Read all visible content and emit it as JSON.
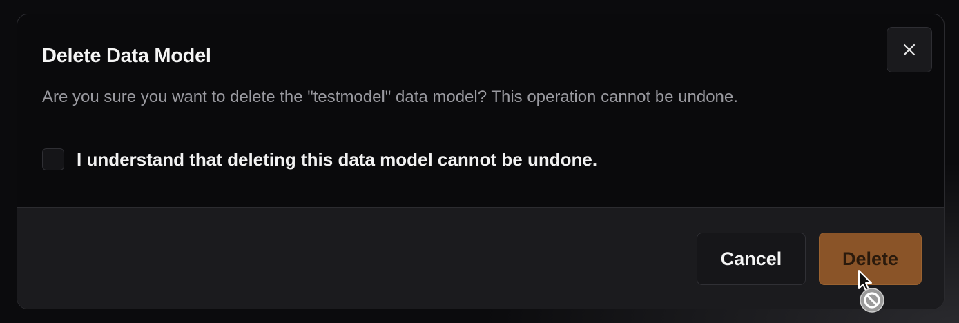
{
  "dialog": {
    "title": "Delete Data Model",
    "description": "Are you sure you want to delete the \"testmodel\" data model? This operation cannot be undone.",
    "confirm_label": "I understand that deleting this data model cannot be undone.",
    "confirm_checked": false,
    "close_icon": "close-icon",
    "cancel_label": "Cancel",
    "delete_label": "Delete",
    "delete_disabled": true
  },
  "colors": {
    "background": "#0a0a0c",
    "footer": "#1b1b1e",
    "delete_accent": "#8a5428",
    "muted_text": "#9a9aa0"
  },
  "cursor": {
    "type": "not-allowed-pointer"
  }
}
